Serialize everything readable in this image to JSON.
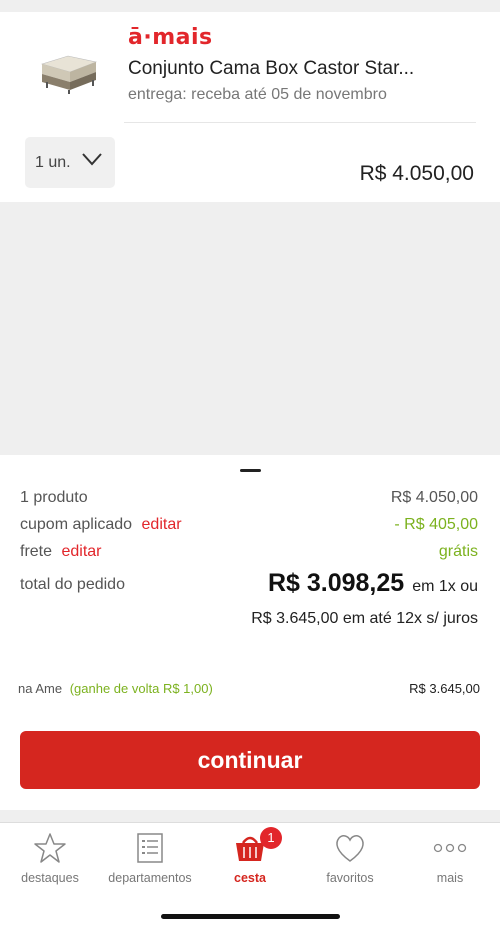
{
  "product": {
    "brand": "ā·mais",
    "title": "Conjunto Cama Box Castor Star...",
    "delivery": "entrega: receba até 05 de novembro",
    "quantity": "1 un.",
    "price": "R$ 4.050,00"
  },
  "summary": {
    "products_label": "1 produto",
    "products_value": "R$ 4.050,00",
    "coupon_label": "cupom aplicado",
    "coupon_edit": "editar",
    "coupon_value": "- R$ 405,00",
    "shipping_label": "frete",
    "shipping_edit": "editar",
    "shipping_value": "grátis",
    "total_label": "total do pedido",
    "total_value": "R$ 3.098,25",
    "total_suffix": "em 1x ou",
    "installments": "R$ 3.645,00 em até 12x s/ juros",
    "ame_label": "na Ame",
    "ame_cashback": "(ganhe de volta R$ 1,00)",
    "ame_value": "R$ 3.645,00",
    "continue_label": "continuar"
  },
  "tabs": [
    {
      "label": "destaques",
      "icon": "star-icon"
    },
    {
      "label": "departamentos",
      "icon": "list-icon"
    },
    {
      "label": "cesta",
      "icon": "basket-icon",
      "active": true,
      "badge": "1"
    },
    {
      "label": "favoritos",
      "icon": "heart-icon"
    },
    {
      "label": "mais",
      "icon": "more-icon"
    }
  ],
  "colors": {
    "brand_red": "#d5261f",
    "discount_green": "#7cb21f"
  }
}
